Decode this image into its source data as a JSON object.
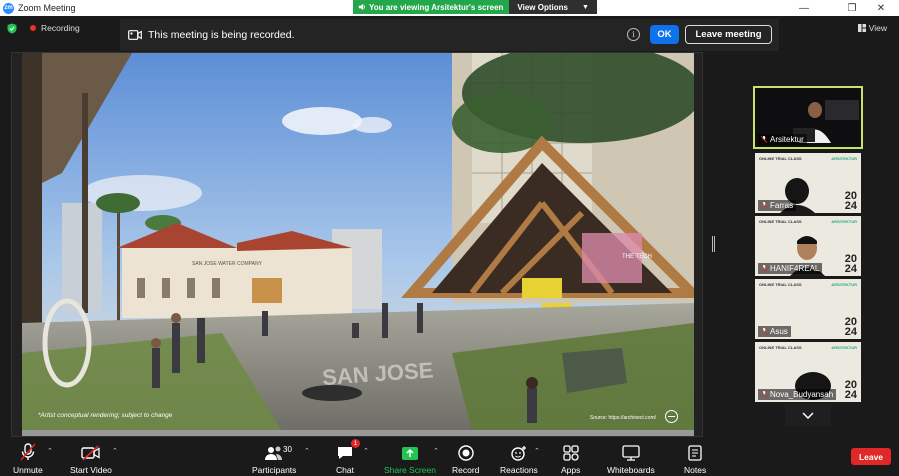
{
  "window": {
    "title": "Zoom Meeting",
    "app_logo": "zm",
    "controls": [
      "minimize-icon",
      "maximize-icon",
      "close-icon"
    ]
  },
  "share_banner": {
    "message": "You are viewing Arsitektur's screen",
    "view_options": "View Options",
    "color": "#23a74b"
  },
  "status": {
    "recording_label": "Recording",
    "view_label": "View"
  },
  "notice": {
    "text": "This meeting is being recorded.",
    "info_symbol": "i",
    "ok_label": "OK",
    "leave_meeting_label": "Leave meeting",
    "ok_color": "#0e72ed"
  },
  "shared_screen": {
    "caption_left": "*Artist conceptual rendering; subject to change",
    "caption_right": "Source: https://archinect.com/",
    "pavement_text": "SAN JOSE",
    "sign_text": "SAN JOSE WATER COMPANY",
    "building_sign": "THE TECH"
  },
  "participants": [
    {
      "name": "Arsitektur",
      "active": true
    },
    {
      "name": "Farras",
      "active": false
    },
    {
      "name": "HANIF4REAL",
      "active": false
    },
    {
      "name": "Asus",
      "active": false
    },
    {
      "name": "Nova_Budyansah",
      "active": false
    }
  ],
  "slide": {
    "title": "ONLINE TRIAL CLASS",
    "logo": "ARSITEKTUR",
    "year_top": "20",
    "year_bottom": "24"
  },
  "toolbar": {
    "unmute": "Unmute",
    "start_video": "Start Video",
    "participants": "Participants",
    "participants_count": "30",
    "chat": "Chat",
    "chat_badge": "1",
    "share_screen": "Share Screen",
    "record": "Record",
    "reactions": "Reactions",
    "apps": "Apps",
    "whiteboards": "Whiteboards",
    "notes": "Notes",
    "leave": "Leave",
    "leave_color": "#e02828"
  }
}
